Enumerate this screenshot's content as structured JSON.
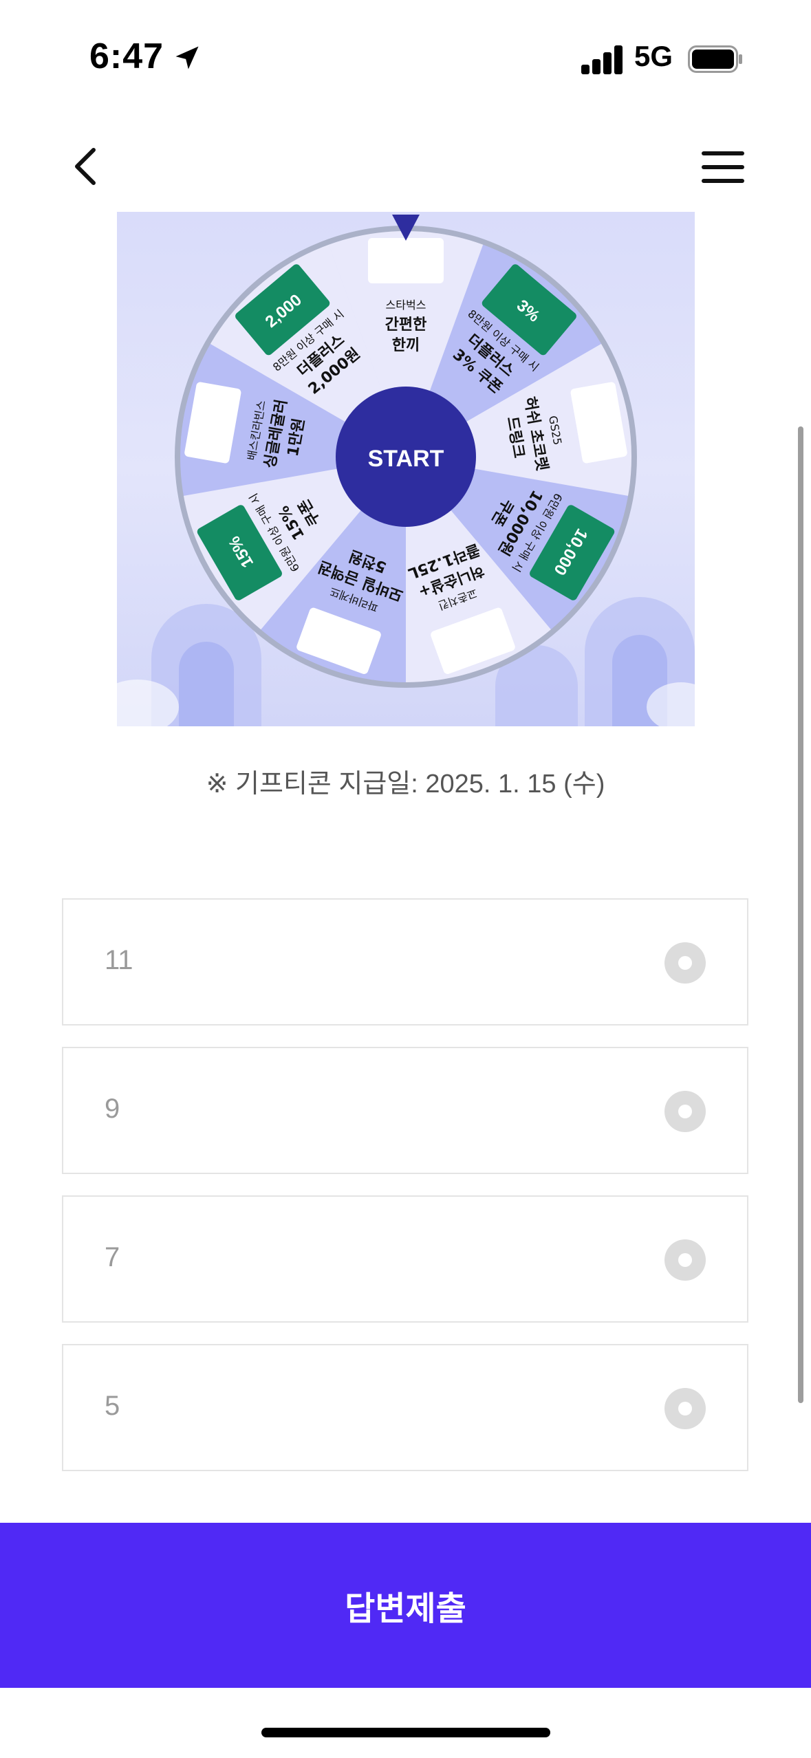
{
  "status_bar": {
    "time": "6:47",
    "network": "5G"
  },
  "icons": {
    "back": "chevron-left-icon",
    "menu": "hamburger-menu-icon",
    "location": "location-arrow-icon"
  },
  "roulette": {
    "start_label": "START",
    "segments": [
      {
        "lines": [
          "스타벅스",
          "간편한",
          "한끼"
        ]
      },
      {
        "lines": [
          "8만원 이상 구매 시",
          "더플러스",
          "3% 쿠폰"
        ],
        "card": "3%"
      },
      {
        "lines": [
          "GS25",
          "허쉬 초코렛",
          "드링크"
        ]
      },
      {
        "lines": [
          "6만원 이상 구매 시",
          "10,000원",
          "쿠폰"
        ],
        "card": "10,000"
      },
      {
        "lines": [
          "교촌치킨",
          "허니순살+",
          "콜라1.25L"
        ]
      },
      {
        "lines": [
          "파리바게뜨",
          "모바일 금액권",
          "5천원"
        ]
      },
      {
        "lines": [
          "6만원 이상 구매 시",
          "15%",
          "쿠폰"
        ],
        "card": "15%"
      },
      {
        "lines": [
          "배스킨라빈스",
          "싱글레귤러",
          "1만원"
        ]
      },
      {
        "lines": [
          "8만원 이상 구매 시",
          "더플러스",
          "2,000원"
        ],
        "card": "2,000"
      }
    ]
  },
  "gift_note": "※ 기프티콘 지급일: 2025. 1. 15 (수)",
  "options": [
    {
      "label": "11"
    },
    {
      "label": "9"
    },
    {
      "label": "7"
    },
    {
      "label": "5"
    }
  ],
  "submit_label": "답변제출",
  "colors": {
    "accent": "#5029f5",
    "wheel_center": "#2e2d9f",
    "coupon_green": "#148c63"
  }
}
